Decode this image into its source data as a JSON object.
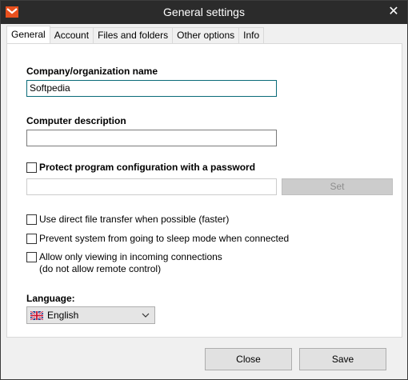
{
  "window": {
    "title": "General settings",
    "close_glyph": "✕"
  },
  "tabs": [
    {
      "label": "General"
    },
    {
      "label": "Account"
    },
    {
      "label": "Files and folders"
    },
    {
      "label": "Other options"
    },
    {
      "label": "Info"
    }
  ],
  "company": {
    "label": "Company/organization name",
    "value": "Softpedia"
  },
  "computer": {
    "label": "Computer description",
    "value": ""
  },
  "password": {
    "label": "Protect program configuration with a password",
    "checked": false,
    "value": "",
    "set_button": "Set"
  },
  "options": [
    {
      "label": "Use direct file transfer when possible (faster)",
      "checked": false
    },
    {
      "label": "Prevent system from going to sleep mode when connected",
      "checked": false
    },
    {
      "label": "Allow only viewing in incoming connections",
      "sublabel": "(do not allow remote control)",
      "checked": false
    }
  ],
  "language": {
    "label": "Language:",
    "selected": "English",
    "flag_icon": "uk-flag-icon"
  },
  "footer": {
    "close_button": "Close",
    "save_button": "Save"
  },
  "colors": {
    "titlebar": "#2b2b2b",
    "accent_icon": "#e8501e",
    "focus_border": "#0a6b78"
  }
}
